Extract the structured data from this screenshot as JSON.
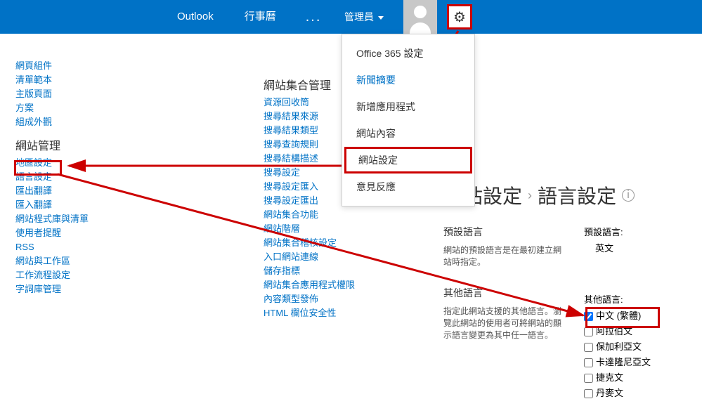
{
  "header": {
    "nav": [
      "Outlook",
      "行事曆"
    ],
    "user": "管理員"
  },
  "dropdown": {
    "items": [
      "Office 365 設定",
      "新聞摘要",
      "新增應用程式",
      "網站內容",
      "網站設定",
      "意見反應"
    ]
  },
  "sidebar1": {
    "group0": [
      "網頁組件",
      "清單範本",
      "主版頁面",
      "方案",
      "組成外觀"
    ],
    "h1": "網站管理",
    "group1": [
      "地區設定",
      "語言設定",
      "匯出翻譯",
      "匯入翻譯",
      "網站程式庫與清單",
      "使用者提醒",
      "RSS",
      "網站與工作區",
      "工作流程設定",
      "字詞庫管理"
    ]
  },
  "sidebar2": {
    "h0": "網站集合管理",
    "group0": [
      "資源回收筒",
      "搜尋結果來源",
      "搜尋結果類型",
      "搜尋查詢規則",
      "搜尋結構描述",
      "搜尋設定",
      "搜尋設定匯入",
      "搜尋設定匯出",
      "網站集合功能",
      "網站階層",
      "網站集合稽核設定",
      "入口網站連線",
      "儲存指標",
      "網站集合應用程式權限",
      "內容類型發佈",
      "HTML 欄位安全性"
    ]
  },
  "breadcrumb": {
    "a": "網站設定",
    "b": "語言設定"
  },
  "settings": {
    "sec1_h": "預設語言",
    "sec1_desc": "網站的預設語言是在最初建立網站時指定。",
    "sec1_label": "預設語言:",
    "sec1_value": "英文",
    "sec2_h": "其他語言",
    "sec2_desc": "指定此網站支援的其他語言。瀏覽此網站的使用者可將網站的顯示語言變更為其中任一語言。",
    "sec2_label": "其他語言:",
    "langs": [
      "中文 (繁體)",
      "阿拉伯文",
      "保加利亞文",
      "卡達隆尼亞文",
      "捷克文",
      "丹麥文"
    ]
  }
}
